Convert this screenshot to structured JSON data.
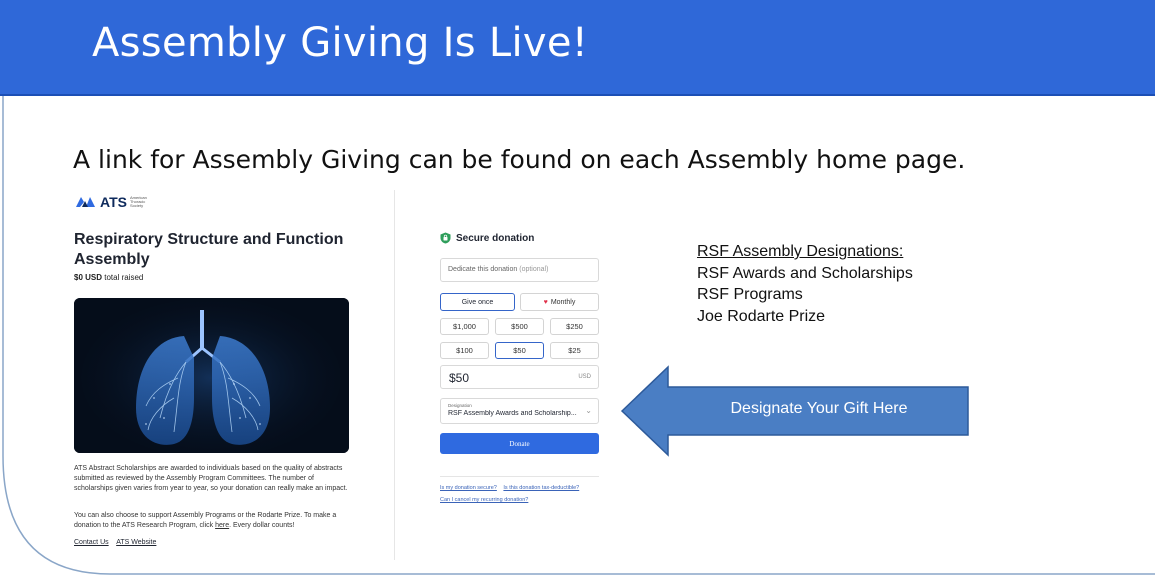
{
  "slide": {
    "title": "Assembly Giving Is Live!",
    "subtitle": "A link for Assembly Giving can be found on each Assembly home page.",
    "colors": {
      "banner": "#2f68d8",
      "arrow": "#4a7ec4",
      "arrow_border": "#2d5a9a",
      "donate": "#2f6ae0",
      "selected_border": "#3565c9"
    }
  },
  "campaign": {
    "logo_text": "ATS",
    "logo_small": "American Thoracic Society",
    "title": "Respiratory Structure and Function Assembly",
    "raised_amount": "$0 USD",
    "raised_label": "total raised",
    "image": "lungs-illustration",
    "desc1": "ATS Abstract Scholarships are awarded to individuals based on the quality of abstracts submitted as reviewed by the Assembly Program Committees. The number of scholarships given varies from year to year, so your donation can really make an impact.",
    "desc2_pre": "You can also choose to support Assembly Programs or the Rodarte Prize. To make a donation to the ATS Research Program, click ",
    "desc2_link": "here",
    "desc2_post": ". Every dollar counts!",
    "link_contact": "Contact Us",
    "link_website": "ATS Website"
  },
  "donation_form": {
    "heading": "Secure donation",
    "dedicate_placeholder": "Dedicate this donation",
    "dedicate_optional": "(optional)",
    "freq_once": "Give once",
    "freq_monthly": "Monthly",
    "amounts": [
      "$1,000",
      "$500",
      "$250",
      "$100",
      "$50",
      "$25"
    ],
    "selected_amount": "$50",
    "amount_value": "$50",
    "currency": "USD",
    "designation_label": "Designation",
    "designation_value": "RSF Assembly Awards and Scholarship...",
    "donate_label": "Donate",
    "faq1": "Is my donation secure?",
    "faq2": "Is this donation tax-deductible?",
    "faq3": "Can I cancel my recurring donation?"
  },
  "designations": {
    "heading": "RSF Assembly Designations:",
    "items": [
      "RSF Awards and Scholarships",
      "RSF Programs",
      "Joe Rodarte Prize"
    ]
  },
  "callout": {
    "label": "Designate Your Gift Here"
  }
}
